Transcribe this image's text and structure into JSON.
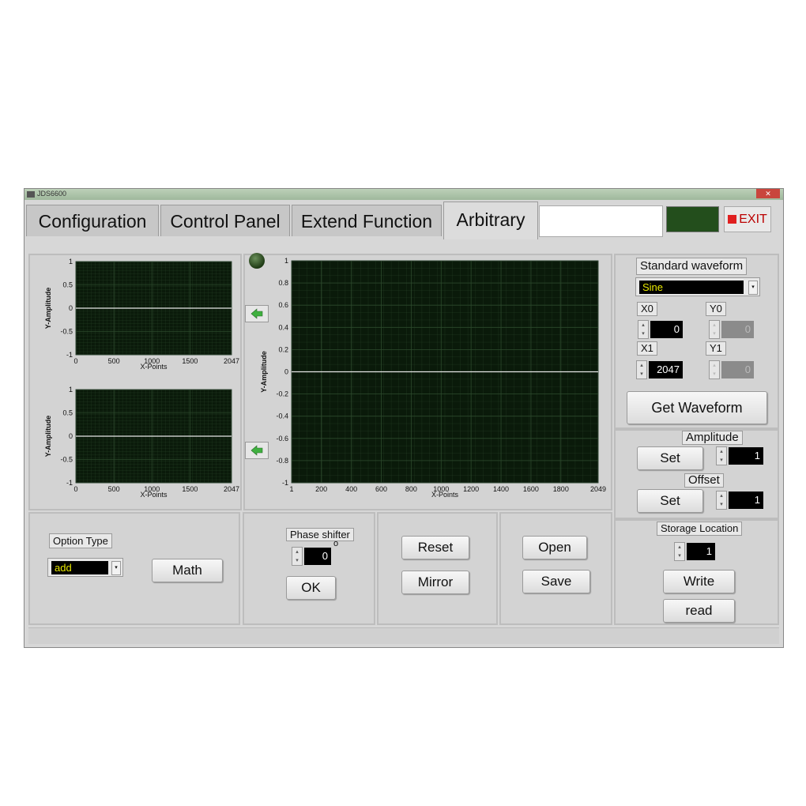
{
  "window": {
    "title": "JDS6600"
  },
  "tabs": [
    {
      "label": "Configuration"
    },
    {
      "label": "Control Panel"
    },
    {
      "label": "Extend Function"
    },
    {
      "label": "Arbitrary"
    }
  ],
  "active_tab": "Arbitrary",
  "exit_label": "EXIT",
  "colors": {
    "plot_bg": "#0a1a0a",
    "grid": "#2d4a2d",
    "trace": "#e6e6e6",
    "led": "#234e1c",
    "exit_red": "#e02020"
  },
  "left_plots": {
    "ylabel": "Y-Amplitude",
    "xlabel": "X-Points",
    "yticks": [
      "1",
      "0.5",
      "0",
      "-0.5",
      "-1"
    ],
    "xticks": [
      "0",
      "500",
      "1000",
      "1500",
      "2047"
    ]
  },
  "main_plot": {
    "ylabel": "Y-Amplitude",
    "xlabel": "X-Points",
    "yticks": [
      "1",
      "0.8",
      "0.6",
      "0.4",
      "0.2",
      "0",
      "-0.2",
      "-0.4",
      "-0.6",
      "-0.8",
      "-1"
    ],
    "xticks": [
      "1",
      "200",
      "400",
      "600",
      "800",
      "1000",
      "1200",
      "1400",
      "1600",
      "1800",
      "2049"
    ]
  },
  "chart_data": [
    {
      "type": "line",
      "xlabel": "X-Points",
      "ylabel": "Y-Amplitude",
      "xlim": [
        0,
        2047
      ],
      "ylim": [
        -1,
        1
      ],
      "x": [
        0,
        2047
      ],
      "y": [
        0,
        0
      ]
    },
    {
      "type": "line",
      "xlabel": "X-Points",
      "ylabel": "Y-Amplitude",
      "xlim": [
        0,
        2047
      ],
      "ylim": [
        -1,
        1
      ],
      "x": [
        0,
        2047
      ],
      "y": [
        0,
        0
      ]
    },
    {
      "type": "line",
      "xlabel": "X-Points",
      "ylabel": "Y-Amplitude",
      "xlim": [
        1,
        2049
      ],
      "ylim": [
        -1,
        1
      ],
      "x": [
        1,
        2049
      ],
      "y": [
        0,
        0
      ]
    }
  ],
  "standard_waveform": {
    "label": "Standard waveform",
    "value": "Sine"
  },
  "x0": {
    "label": "X0",
    "value": "0"
  },
  "y0": {
    "label": "Y0",
    "value": "0"
  },
  "x1": {
    "label": "X1",
    "value": "2047"
  },
  "y1": {
    "label": "Y1",
    "value": "0"
  },
  "get_waveform_label": "Get Waveform",
  "amplitude": {
    "label": "Amplitude",
    "set_label": "Set",
    "value": "1"
  },
  "offset": {
    "label": "Offset",
    "set_label": "Set",
    "value": "1"
  },
  "option_type": {
    "label": "Option Type",
    "value": "add"
  },
  "math_label": "Math",
  "phase_shifter": {
    "label": "Phase shifter",
    "value": "0",
    "unit": "o",
    "ok_label": "OK"
  },
  "reset_label": "Reset",
  "mirror_label": "Mirror",
  "open_label": "Open",
  "save_label": "Save",
  "storage": {
    "label": "Storage Location",
    "value": "1",
    "write_label": "Write",
    "read_label": "read"
  }
}
